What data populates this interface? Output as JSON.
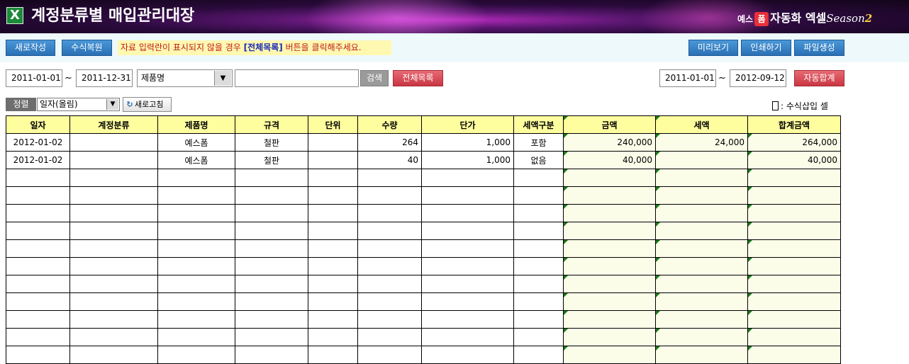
{
  "header": {
    "title": "계정분류별 매입관리대장",
    "app_icon": "excel-icon",
    "brand": {
      "prefix": "예스",
      "badge": "폼",
      "name": "자동화 엑셀",
      "season": "Season",
      "season_num": "2"
    }
  },
  "toolbar": {
    "new_label": "새로작성",
    "restore_label": "수식복원",
    "notice_pre": "자료 입력란이 표시되지  않을 경우 ",
    "notice_strong": "[전체목록]",
    "notice_post": " 버튼을 클릭해주세요.",
    "preview_label": "미리보기",
    "print_label": "인쇄하기",
    "file_label": "파일생성"
  },
  "filter": {
    "date_from": "2011-01-01",
    "date_to": "2011-12-31",
    "tilde": "~",
    "field_select": "제품명",
    "search_value": "",
    "search_label": "검색",
    "all_list_label": "전체목록",
    "sum_date_from": "2011-01-01",
    "sum_date_to": "2012-09-12",
    "auto_sum_label": "자동합계"
  },
  "sort": {
    "label": "정렬",
    "value": "일자(올림)",
    "refresh_label": "새로고침",
    "legend_text": ": 수식삽입 셀"
  },
  "table": {
    "headers": [
      "일자",
      "계정분류",
      "제품명",
      "규격",
      "단위",
      "수량",
      "단가",
      "세액구분",
      "금액",
      "세액",
      "합계금액"
    ],
    "rows": [
      [
        "2012-01-02",
        "",
        "예스폼",
        "철판",
        "",
        "264",
        "1,000",
        "포함",
        "240,000",
        "24,000",
        "264,000"
      ],
      [
        "2012-01-02",
        "",
        "예스폼",
        "철판",
        "",
        "40",
        "1,000",
        "없음",
        "40,000",
        "",
        "40,000"
      ],
      [
        "",
        "",
        "",
        "",
        "",
        "",
        "",
        "",
        "",
        "",
        ""
      ],
      [
        "",
        "",
        "",
        "",
        "",
        "",
        "",
        "",
        "",
        "",
        ""
      ],
      [
        "",
        "",
        "",
        "",
        "",
        "",
        "",
        "",
        "",
        "",
        ""
      ],
      [
        "",
        "",
        "",
        "",
        "",
        "",
        "",
        "",
        "",
        "",
        ""
      ],
      [
        "",
        "",
        "",
        "",
        "",
        "",
        "",
        "",
        "",
        "",
        ""
      ],
      [
        "",
        "",
        "",
        "",
        "",
        "",
        "",
        "",
        "",
        "",
        ""
      ],
      [
        "",
        "",
        "",
        "",
        "",
        "",
        "",
        "",
        "",
        "",
        ""
      ],
      [
        "",
        "",
        "",
        "",
        "",
        "",
        "",
        "",
        "",
        "",
        ""
      ],
      [
        "",
        "",
        "",
        "",
        "",
        "",
        "",
        "",
        "",
        "",
        ""
      ],
      [
        "",
        "",
        "",
        "",
        "",
        "",
        "",
        "",
        "",
        "",
        ""
      ],
      [
        "",
        "",
        "",
        "",
        "",
        "",
        "",
        "",
        "",
        "",
        ""
      ],
      [
        "",
        "",
        "",
        "",
        "",
        "",
        "",
        "",
        "",
        "",
        ""
      ]
    ]
  },
  "colors": {
    "header_bg": "#fffe9f",
    "formula_cell_bg": "#fcfde9",
    "formula_marker": "#1a7a1a",
    "button_blue": "#2a6fb5",
    "button_red": "#c93643",
    "notice_text": "#c01818"
  }
}
